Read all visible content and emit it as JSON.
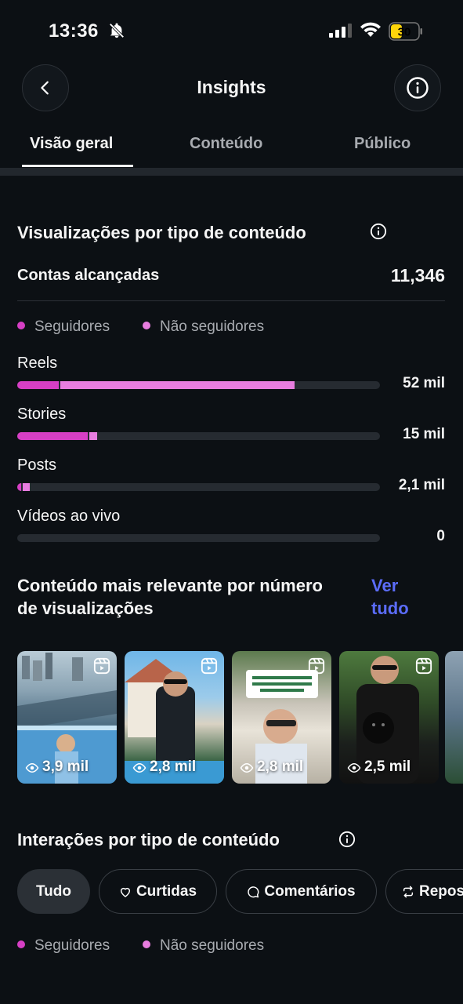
{
  "status_bar": {
    "time": "13:36",
    "battery": "30"
  },
  "header": {
    "title": "Insights"
  },
  "tabs": [
    {
      "label": "Visão geral"
    },
    {
      "label": "Conteúdo"
    },
    {
      "label": "Público"
    }
  ],
  "views_section": {
    "title": "Visualizações por tipo de conteúdo",
    "reach_label": "Contas alcançadas",
    "reach_value": "11,346",
    "legend": {
      "followers": "Seguidores",
      "non_followers": "Não seguidores"
    },
    "colors": {
      "followers": "#d63fc4",
      "non_followers": "#e87ddf",
      "track": "#262b31"
    },
    "bars": [
      {
        "label": "Reels",
        "value": "52 mil",
        "followers_pct": 11.5,
        "non_followers_pct": 64.5
      },
      {
        "label": "Stories",
        "value": "15 mil",
        "followers_pct": 19.5,
        "non_followers_pct": 2.0
      },
      {
        "label": "Posts",
        "value": "2,1 mil",
        "followers_pct": 1.0,
        "non_followers_pct": 2.0
      },
      {
        "label": "Vídeos ao vivo",
        "value": "0",
        "followers_pct": 0,
        "non_followers_pct": 0
      }
    ]
  },
  "relevant_section": {
    "title": "Conteúdo mais relevante por número de visualizações",
    "see_all": "Ver tudo",
    "thumbnails": [
      {
        "views": "3,9 mil"
      },
      {
        "views": "2,8 mil"
      },
      {
        "views": "2,8 mil"
      },
      {
        "views": "2,5 mil"
      }
    ]
  },
  "interactions_section": {
    "title": "Interações por tipo de conteúdo",
    "chips": [
      {
        "label": "Tudo",
        "icon": "none"
      },
      {
        "label": "Curtidas",
        "icon": "heart-icon"
      },
      {
        "label": "Comentários",
        "icon": "comment-icon"
      },
      {
        "label": "Repos",
        "icon": "repost-icon"
      }
    ],
    "legend": {
      "followers": "Seguidores",
      "non_followers": "Não seguidores"
    }
  }
}
